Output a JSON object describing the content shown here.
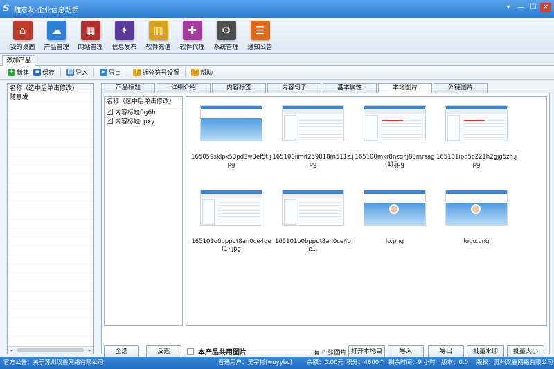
{
  "window": {
    "title": "随意发-企业信息助手",
    "logo_letter": "S",
    "controls": [
      "▾",
      "—",
      "☐",
      "✕"
    ]
  },
  "ribbon": [
    {
      "label": "我的桌面",
      "icon": "house-icon",
      "color": "#c0392b",
      "glyph": "⌂"
    },
    {
      "label": "产品管理",
      "icon": "cloud-icon",
      "color": "#2f7fd6",
      "glyph": "☁"
    },
    {
      "label": "网站管理",
      "icon": "building-icon",
      "color": "#b03030",
      "glyph": "▦"
    },
    {
      "label": "信息发布",
      "icon": "magic-wand-icon",
      "color": "#5b3a99",
      "glyph": "✦"
    },
    {
      "label": "软件充值",
      "icon": "coins-icon",
      "color": "#d8a21c",
      "glyph": "▥"
    },
    {
      "label": "软件代理",
      "icon": "gift-icon",
      "color": "#a33b9c",
      "glyph": "✚"
    },
    {
      "label": "系统管理",
      "icon": "gear-icon",
      "color": "#4d4d4d",
      "glyph": "⚙"
    },
    {
      "label": "通知公告",
      "icon": "notebook-icon",
      "color": "#e06a1b",
      "glyph": "☰"
    }
  ],
  "doc_tab": "添加产品",
  "toolbar": [
    {
      "label": "新建",
      "icon": "add-icon",
      "color": "#2e9e3e",
      "glyph": "+"
    },
    {
      "label": "保存",
      "icon": "save-icon",
      "color": "#2f6bb8",
      "glyph": "▪"
    },
    {
      "label": "导入",
      "icon": "import-icon",
      "color": "#4a88c8",
      "glyph": "▤"
    },
    {
      "label": "导出",
      "icon": "export-icon",
      "color": "#3a86cf",
      "glyph": "▸"
    },
    {
      "label": "拆分符号设置",
      "icon": "split-icon",
      "color": "#d9a620",
      "glyph": "↑"
    },
    {
      "label": "帮助",
      "icon": "help-icon",
      "color": "#e5a21a",
      "glyph": "?"
    }
  ],
  "left_list": {
    "header": "名称（选中后单击修改）",
    "rows": [
      "随意发"
    ]
  },
  "tabs": [
    "产品标题",
    "详细介绍",
    "内容标签",
    "内容句子",
    "基本属性",
    "本地图片",
    "外链图片"
  ],
  "active_tab": 5,
  "name_list": {
    "header": "名称（选中后单击修改）",
    "rows": [
      {
        "label": "内容标题0g6h",
        "checked": true
      },
      {
        "label": "内容标题cpxy",
        "checked": true
      }
    ]
  },
  "images": [
    {
      "caption": "165059sklpk53pd3w3ef5t.jpg",
      "style": "sky"
    },
    {
      "caption": "165100iimif259818m511z.jpg",
      "style": "list"
    },
    {
      "caption": "165100mkr8nzqnj83mrsag(1).jpg",
      "style": "list-red"
    },
    {
      "caption": "165101ipq5c221h2gjg5zh.jpg",
      "style": "list-red"
    },
    {
      "caption": "165101o0bpput8an0ce4ge(1).jpg",
      "style": "list"
    },
    {
      "caption": "165101o0bpput8an0ce4ge...",
      "style": "list"
    },
    {
      "caption": "lo.png",
      "style": "login"
    },
    {
      "caption": "logo.png",
      "style": "login"
    }
  ],
  "bottom": {
    "select_all": "全选",
    "invert": "反选",
    "share_label": "本产品共用图片",
    "count_text": "有 8 张图片",
    "open_dir": "打开本地目录",
    "import": "导入",
    "export": "导出",
    "watermark": "批量水印",
    "resize": "批量大小"
  },
  "statusbar": {
    "notice": "官方公告：关于苏州汉鑫网络有限公司",
    "user": "普通用户：吴宇彬(wuyybc)",
    "balance": "余额：0.00元",
    "points": "积分：4600个",
    "remaining": "剩余时间：9 小时",
    "version": "版本：0.0",
    "copyright": "版权：苏州汉鑫网络有限公司"
  },
  "scrollbar": {
    "left_arrow": "◂",
    "right_arrow": "▸"
  }
}
